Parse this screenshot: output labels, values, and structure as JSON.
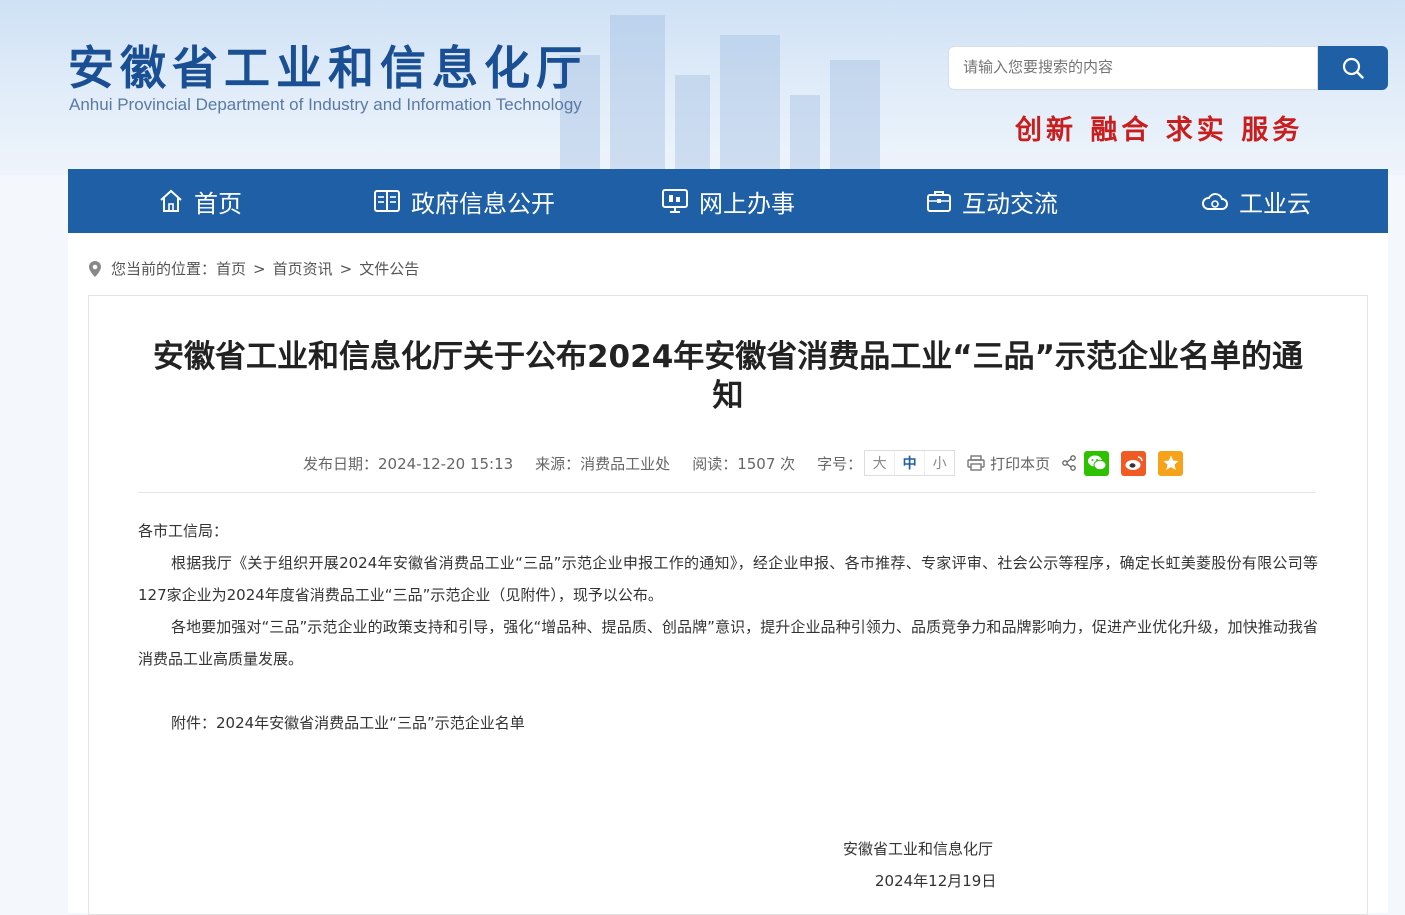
{
  "header": {
    "title_cn": "安徽省工业和信息化厅",
    "title_en": "Anhui Provincial Department of Industry and Information Technology",
    "search_placeholder": "请输入您要搜索的内容",
    "slogan": "创新 融合 求实 服务"
  },
  "nav": {
    "items": [
      {
        "label": "首页",
        "icon": "home-icon"
      },
      {
        "label": "政府信息公开",
        "icon": "book-icon"
      },
      {
        "label": "网上办事",
        "icon": "monitor-icon"
      },
      {
        "label": "互动交流",
        "icon": "briefcase-icon"
      },
      {
        "label": "工业云",
        "icon": "cloud-gear-icon"
      }
    ]
  },
  "breadcrumb": {
    "prefix": "您当前的位置：",
    "items": [
      "首页",
      "首页资讯",
      "文件公告"
    ],
    "separator": ">"
  },
  "article": {
    "title": "安徽省工业和信息化厅关于公布2024年安徽省消费品工业“三品”示范企业名单的通知",
    "meta": {
      "date": "发布日期：2024-12-20 15:13",
      "source": "来源：消费品工业处",
      "reads": "阅读：1507 次",
      "font_label": "字号：",
      "font_sizes": [
        "大",
        "中",
        "小"
      ],
      "print_label": "打印本页"
    },
    "greeting": "各市工信局：",
    "paragraphs": [
      "根据我厅《关于组织开展2024年安徽省消费品工业“三品”示范企业申报工作的通知》，经企业申报、各市推荐、专家评审、社会公示等程序，确定长虹美菱股份有限公司等127家企业为2024年度省消费品工业“三品”示范企业（见附件），现予以公布。",
      "各地要加强对“三品”示范企业的政策支持和引导，强化“增品种、提品质、创品牌”意识，提升企业品种引领力、品质竞争力和品牌影响力，促进产业优化升级，加快推动我省消费品工业高质量发展。"
    ],
    "attachment": "附件：2024年安徽省消费品工业“三品”示范企业名单",
    "signer": "安徽省工业和信息化厅",
    "sign_date": "2024年12月19日"
  },
  "colors": {
    "nav_bg": "#1f5fa6",
    "title_blue": "#1a4f94",
    "slogan_red": "#c81e1e",
    "wechat": "#2dc100",
    "weibo": "#f05a24",
    "favorite": "#f7a21b"
  }
}
